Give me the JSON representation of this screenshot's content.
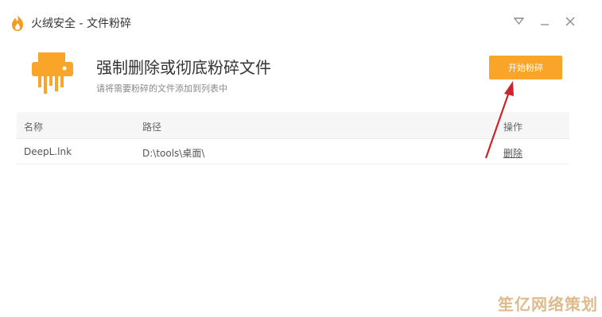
{
  "titlebar": {
    "title": "火绒安全 - 文件粉碎"
  },
  "header": {
    "title": "强制删除或彻底粉碎文件",
    "subtitle": "请将需要粉碎的文件添加到列表中",
    "start_button_label": "开始粉碎"
  },
  "table": {
    "columns": {
      "name": "名称",
      "path": "路径",
      "action": "操作"
    },
    "rows": [
      {
        "name": "DeepL.lnk",
        "path": "D:\\tools\\桌面\\",
        "action": "删除"
      }
    ]
  },
  "watermark": {
    "text": "笙亿网络策划"
  },
  "colors": {
    "accent": "#f8a52a",
    "annotation_arrow": "#c8262a",
    "watermark": "#d9b07a"
  },
  "icons": {
    "app_logo": "flame-shield-icon",
    "header": "shredder-icon",
    "minimize_to_tray": "triangle-down-icon",
    "minimize": "minimize-icon",
    "close": "close-icon"
  }
}
